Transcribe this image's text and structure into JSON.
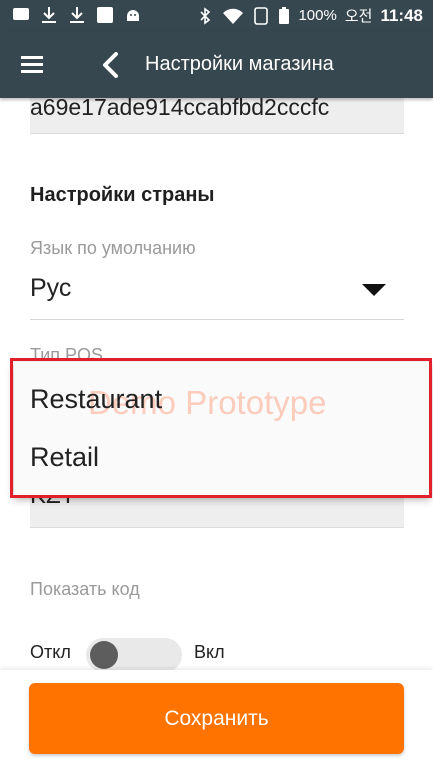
{
  "status_bar": {
    "battery": "100%",
    "carrier": "오전",
    "time": "11:48"
  },
  "app_bar": {
    "title": "Настройки магазина"
  },
  "form": {
    "token_value": "a69e17ade914ccabfbd2cccfc",
    "section_country": "Настройки страны",
    "language_label": "Язык по умолчанию",
    "language_value": "Рус",
    "pos_type_label": "Тип POS",
    "currency_value": "KZT",
    "show_code_label": "Показать код",
    "toggle_off_label": "Откл",
    "toggle_on_label": "Вкл"
  },
  "dropdown": {
    "options": [
      "Restaurant",
      "Retail"
    ],
    "watermark": "Demo Prototype"
  },
  "footer": {
    "save_label": "Сохранить"
  },
  "colors": {
    "app_bar": "#37474f",
    "save_button": "#ff7300",
    "highlight_border": "#e2202c"
  },
  "icons": [
    "menu-icon",
    "back-arrow-icon",
    "dropdown-arrow-icon",
    "wifi-icon",
    "bluetooth-icon",
    "battery-icon"
  ]
}
